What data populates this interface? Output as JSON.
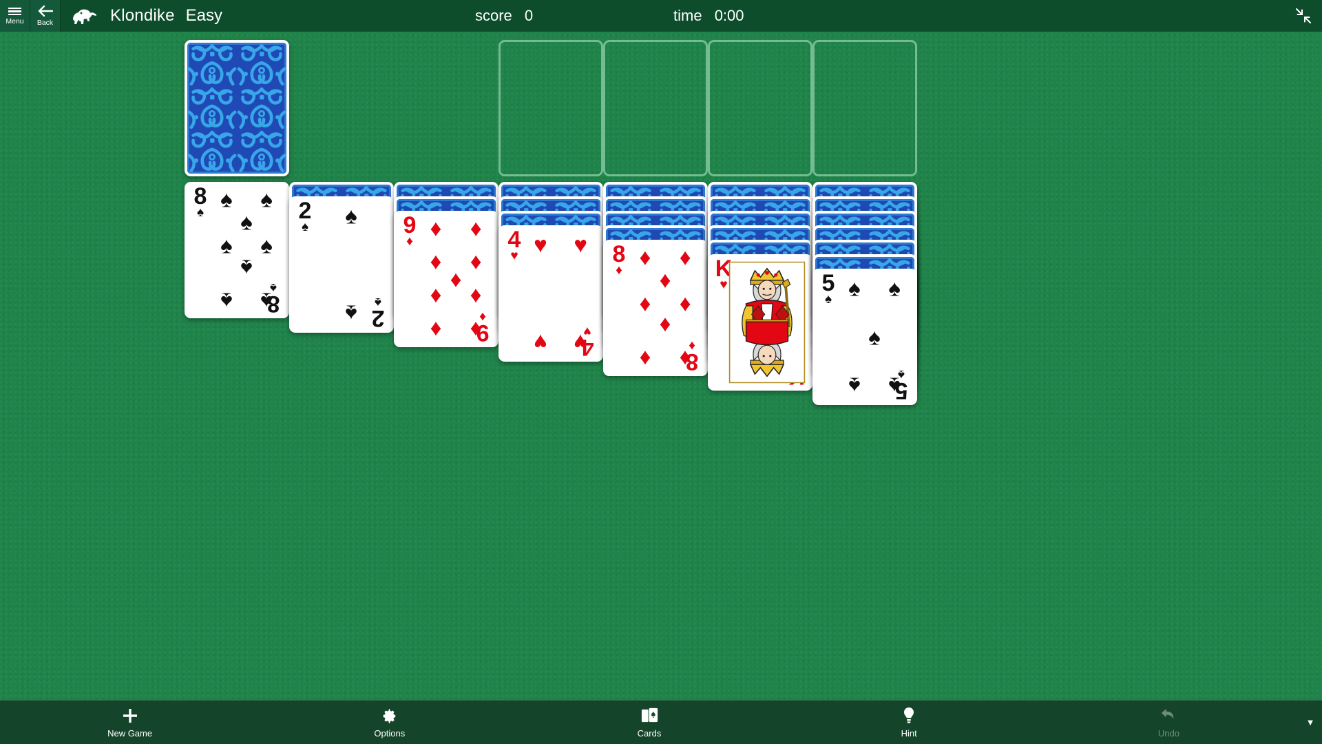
{
  "header": {
    "menu_label": "Menu",
    "menu_icon": "hamburger-icon",
    "back_label": "Back",
    "back_icon": "arrow-left-icon",
    "logo_icon": "polar-bear-icon",
    "title": "Klondike",
    "difficulty": "Easy",
    "score_label": "score",
    "score_value": "0",
    "time_label": "time",
    "time_value": "0:00",
    "exit_fullscreen_icon": "exit-fullscreen-icon"
  },
  "colors": {
    "felt": "#1e8449",
    "header_bar": "#0d4d2b",
    "app_bar": "#14452b",
    "card_back_blue": "#1f49b5",
    "card_back_light": "#38a6e8",
    "red_suit": "#e30613",
    "black_suit": "#111111",
    "slot_outline": "rgba(185,235,205,0.55)"
  },
  "board": {
    "stock": {
      "name": "stock-pile",
      "face_down_count": 24,
      "card_back": "blue-damask"
    },
    "waste": {
      "name": "waste-pile",
      "cards": []
    },
    "foundations": [
      {
        "name": "foundation-1",
        "empty": true
      },
      {
        "name": "foundation-2",
        "empty": true
      },
      {
        "name": "foundation-3",
        "empty": true
      },
      {
        "name": "foundation-4",
        "empty": true
      }
    ],
    "tableau": [
      {
        "name": "tableau-column-1",
        "face_down": 0,
        "top_card": {
          "rank": "8",
          "suit": "spades",
          "suit_glyph": "♠",
          "color": "black"
        }
      },
      {
        "name": "tableau-column-2",
        "face_down": 1,
        "top_card": {
          "rank": "2",
          "suit": "spades",
          "suit_glyph": "♠",
          "color": "black"
        }
      },
      {
        "name": "tableau-column-3",
        "face_down": 2,
        "top_card": {
          "rank": "9",
          "suit": "diamonds",
          "suit_glyph": "♦",
          "color": "red"
        }
      },
      {
        "name": "tableau-column-4",
        "face_down": 3,
        "top_card": {
          "rank": "4",
          "suit": "hearts",
          "suit_glyph": "♥",
          "color": "red"
        }
      },
      {
        "name": "tableau-column-5",
        "face_down": 4,
        "top_card": {
          "rank": "8",
          "suit": "diamonds",
          "suit_glyph": "♦",
          "color": "red"
        }
      },
      {
        "name": "tableau-column-6",
        "face_down": 5,
        "top_card": {
          "rank": "K",
          "suit": "hearts",
          "suit_glyph": "♥",
          "color": "red",
          "court": true
        }
      },
      {
        "name": "tableau-column-7",
        "face_down": 6,
        "top_card": {
          "rank": "5",
          "suit": "spades",
          "suit_glyph": "♠",
          "color": "black"
        }
      }
    ]
  },
  "appbar": {
    "buttons": [
      {
        "name": "new-game-button",
        "label": "New Game",
        "icon": "plus-icon",
        "enabled": true
      },
      {
        "name": "options-button",
        "label": "Options",
        "icon": "gear-icon",
        "enabled": true
      },
      {
        "name": "cards-button",
        "label": "Cards",
        "icon": "cards-icon",
        "enabled": true
      },
      {
        "name": "hint-button",
        "label": "Hint",
        "icon": "lightbulb-icon",
        "enabled": true
      },
      {
        "name": "undo-button",
        "label": "Undo",
        "icon": "undo-arrow-icon",
        "enabled": false
      }
    ],
    "more_icon": "chevron-down-icon"
  }
}
